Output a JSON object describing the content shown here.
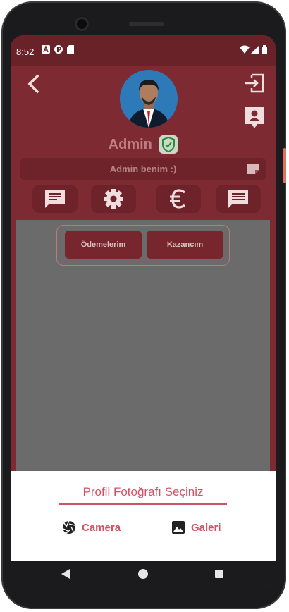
{
  "status_bar": {
    "time": "8:52"
  },
  "profile": {
    "name": "Admin",
    "bio": "Admin benim :)"
  },
  "tabs": [
    {
      "label": "Ödemelerim"
    },
    {
      "label": "Kazancım"
    }
  ],
  "bottom_sheet": {
    "title": "Profil Fotoğrafı Seçiniz",
    "options": [
      {
        "label": "Camera",
        "icon": "camera-shutter-icon"
      },
      {
        "label": "Galeri",
        "icon": "image-icon"
      }
    ]
  },
  "colors": {
    "app_background": "#7d2a32",
    "accent": "#d05265",
    "content_panel": "#6b6b6b"
  }
}
